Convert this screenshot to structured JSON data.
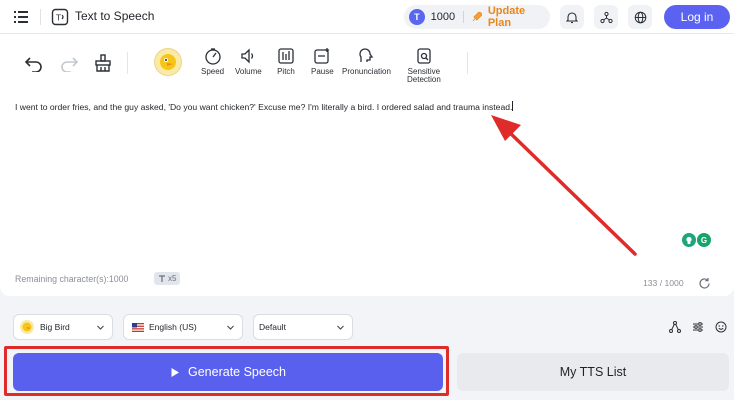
{
  "header": {
    "title": "Text to Speech",
    "credits": "1000",
    "update_plan": "Update Plan",
    "login": "Log in"
  },
  "toolbar": {
    "speed": "Speed",
    "volume": "Volume",
    "pitch": "Pitch",
    "pause": "Pause",
    "pronunciation": "Pronunciation",
    "sensitive_line1": "Sensitive",
    "sensitive_line2": "Detection"
  },
  "editor": {
    "text": "I went to order fries, and the guy asked, 'Do you want chicken?' Excuse me? I'm literally a bird. I ordered salad and trauma instead.",
    "remaining": "Remaining character(s):1000",
    "multiplier": "x5",
    "counter": "133 / 1000"
  },
  "selectors": {
    "voice": "Big Bird",
    "language": "English (US)",
    "style": "Default"
  },
  "actions": {
    "generate": "Generate Speech",
    "tts_list": "My TTS List"
  },
  "colors": {
    "accent": "#5a60ee",
    "update_plan": "#e8871a",
    "annotation": "#e02b2b"
  }
}
